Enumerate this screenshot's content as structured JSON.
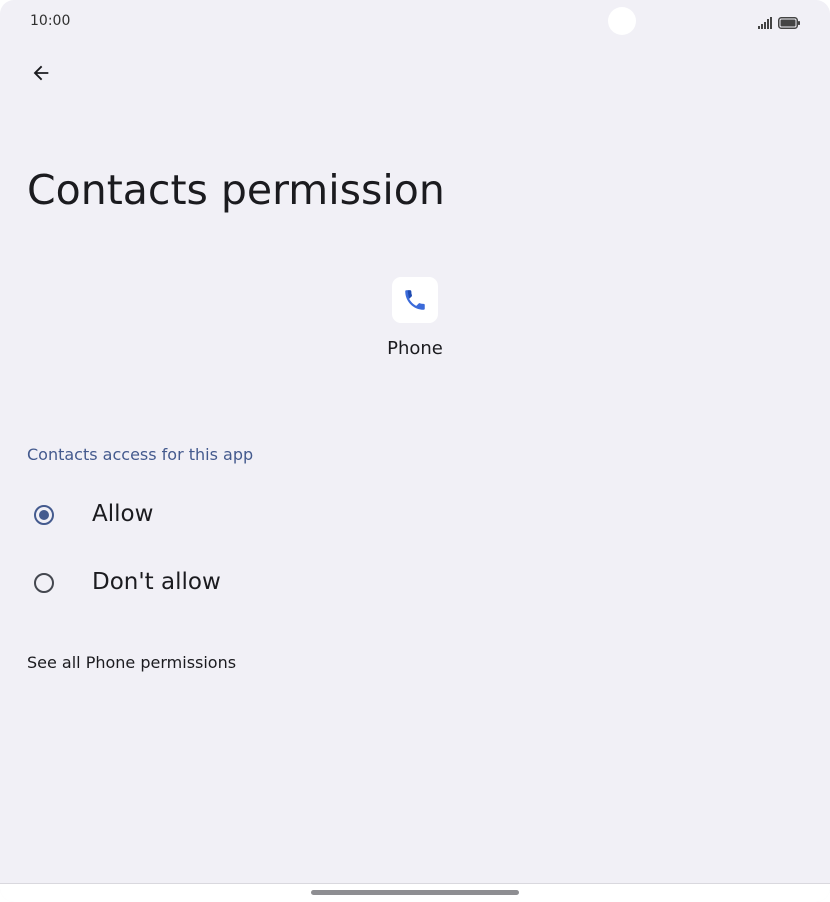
{
  "status_bar": {
    "time": "10:00",
    "icons": [
      "signal-icon",
      "battery-icon"
    ]
  },
  "header": {
    "back_icon": "arrow-back-icon",
    "title": "Contacts permission"
  },
  "app": {
    "icon": "phone-app-icon",
    "name": "Phone"
  },
  "permission": {
    "section_label": "Contacts access for this app",
    "options": [
      {
        "label": "Allow",
        "selected": true
      },
      {
        "label": "Don't allow",
        "selected": false
      }
    ]
  },
  "footer_link": "See all Phone permissions",
  "colors": {
    "background": "#f1f0f6",
    "accent": "#445a8e",
    "text": "#1b1b1f"
  }
}
